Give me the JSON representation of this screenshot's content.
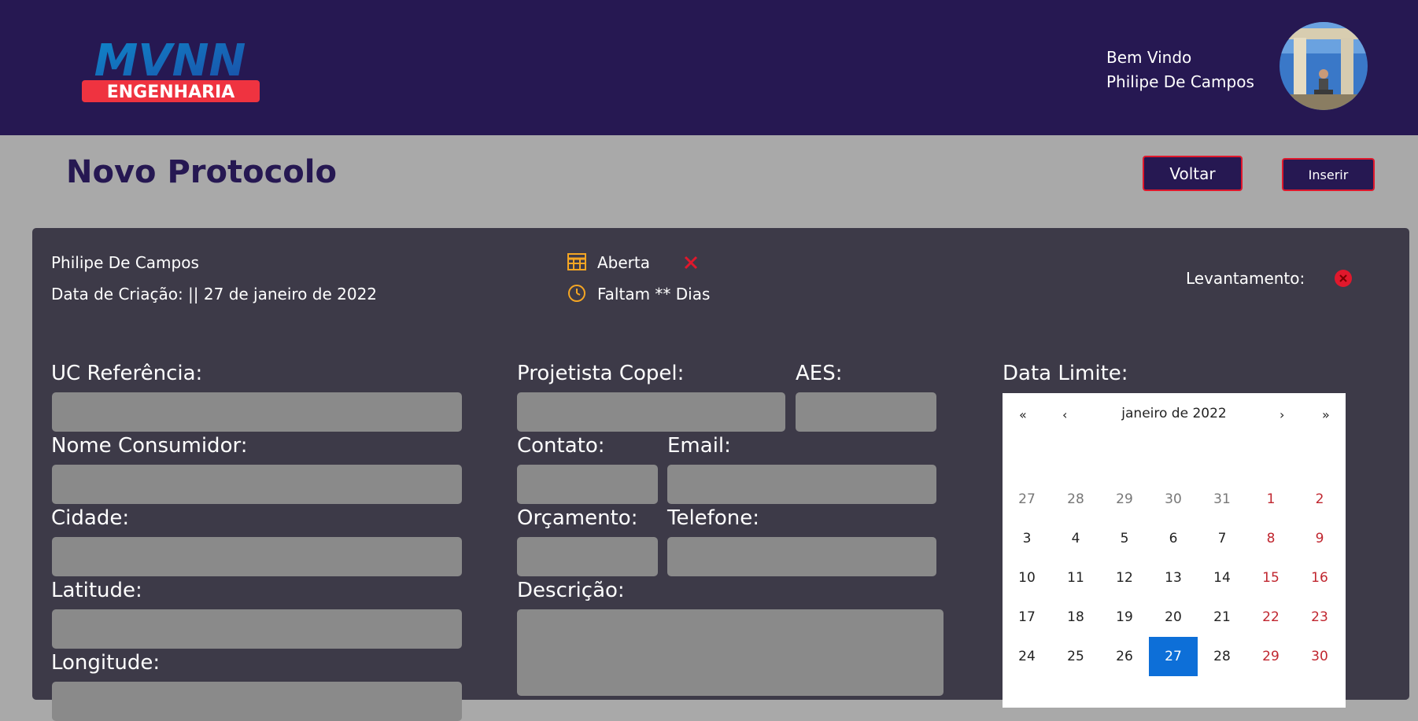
{
  "header": {
    "logo_top": "MVNN",
    "logo_bottom": "ENGENHARIA",
    "welcome": "Bem Vindo",
    "user_name": "Philipe De Campos"
  },
  "page": {
    "title": "Novo Protocolo",
    "back_label": "Voltar",
    "insert_label": "Inserir"
  },
  "info": {
    "author": "Philipe De Campos",
    "created": "Data de Criação: || 27 de janeiro de 2022",
    "status": "Aberta",
    "remaining": "Faltam ** Dias",
    "survey_label": "Levantamento:"
  },
  "form": {
    "uc_label": "UC Referência:",
    "consumer_label": "Nome Consumidor:",
    "city_label": "Cidade:",
    "lat_label": "Latitude:",
    "lng_label": "Longitude:",
    "designer_label": "Projetista Copel:",
    "aes_label": "AES:",
    "contact_label": "Contato:",
    "email_label": "Email:",
    "budget_label": "Orçamento:",
    "phone_label": "Telefone:",
    "desc_label": "Descrição:",
    "deadline_label": "Data Limite:"
  },
  "calendar": {
    "month_label": "janeiro de 2022",
    "prev2": "«",
    "prev": "‹",
    "next": "›",
    "next2": "»",
    "selected": "27",
    "weeks": [
      [
        "27",
        "28",
        "29",
        "30",
        "31",
        "1",
        "2"
      ],
      [
        "3",
        "4",
        "5",
        "6",
        "7",
        "8",
        "9"
      ],
      [
        "10",
        "11",
        "12",
        "13",
        "14",
        "15",
        "16"
      ],
      [
        "17",
        "18",
        "19",
        "20",
        "21",
        "22",
        "23"
      ],
      [
        "24",
        "25",
        "26",
        "27",
        "28",
        "29",
        "30"
      ]
    ]
  },
  "colors": {
    "header_bg": "#261852",
    "accent_red": "#e0182c",
    "icon_orange": "#f5a623",
    "selected_blue": "#0d6fd8"
  }
}
